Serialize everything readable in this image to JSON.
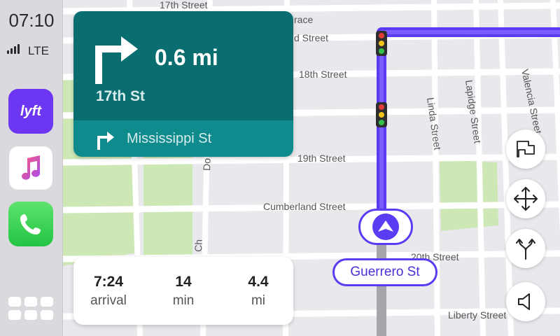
{
  "status": {
    "time": "07:10",
    "network": "LTE"
  },
  "apps": [
    {
      "name": "Lyft",
      "label": "lyft"
    },
    {
      "name": "Music"
    },
    {
      "name": "Phone"
    }
  ],
  "maneuver": {
    "distance": "0.6 mi",
    "street": "17th St",
    "next_street": "Mississippi St",
    "icon": "turn-right-icon"
  },
  "trip": {
    "arrival_value": "7:24",
    "arrival_label": "arrival",
    "duration_value": "14",
    "duration_label": "min",
    "distance_value": "4.4",
    "distance_label": "mi"
  },
  "current_street": "Guerrero St",
  "map_streets": {
    "s17th": "17th Street",
    "s18th": "18th Street",
    "s19th": "19th Street",
    "cumberland": "Cumberland Street",
    "s20th": "20th Street",
    "liberty": "Liberty Street",
    "linda": "Linda Street",
    "lapidge": "Lapidge Street",
    "valencia": "Valencia Street",
    "partial_race": "race",
    "partial_d": "d Street",
    "partial_do": "Do",
    "partial_ch": "Ch"
  },
  "map_buttons": [
    "report-icon",
    "pan-icon",
    "route-options-icon",
    "sound-icon"
  ],
  "colors": {
    "route": "#5b3cf3",
    "maneuver_dark": "#0a6d6f",
    "maneuver_light": "#0f8b8d",
    "park": "#cde8b5"
  }
}
